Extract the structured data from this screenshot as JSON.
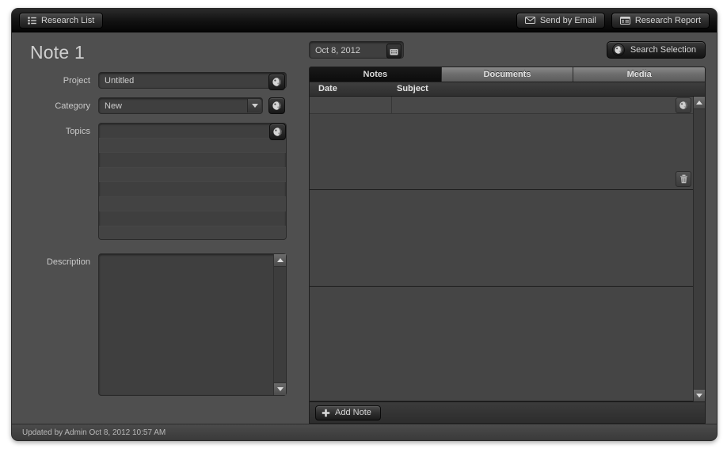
{
  "toolbar": {
    "research_list_label": "Research List",
    "research_list_icon": "list-icon",
    "send_email_label": "Send by Email",
    "send_email_icon": "envelope-icon",
    "research_report_label": "Research Report",
    "research_report_icon": "report-icon"
  },
  "left": {
    "title": "Note 1",
    "fields": {
      "project": {
        "label": "Project",
        "value": "Untitled",
        "icon": "globe-search-icon"
      },
      "category": {
        "label": "Category",
        "value": "New",
        "icon": "globe-search-icon",
        "dropdown_icon": "chevron-down-icon"
      },
      "topics": {
        "label": "Topics",
        "value": "",
        "icon": "globe-search-icon",
        "row_count": 8
      },
      "description": {
        "label": "Description",
        "value": "",
        "scroll_up_icon": "scroll-up-arrow-icon",
        "scroll_down_icon": "scroll-down-arrow-icon"
      }
    }
  },
  "right": {
    "date_field": {
      "value": "Oct 8, 2012",
      "calendar_icon": "calendar-icon"
    },
    "search_selection": {
      "label": "Search Selection",
      "icon": "globe-search-icon"
    },
    "tabs": [
      {
        "label": "Notes",
        "active": true
      },
      {
        "label": "Documents",
        "active": false
      },
      {
        "label": "Media",
        "active": false
      }
    ],
    "columns": [
      {
        "label": "Date"
      },
      {
        "label": "Subject"
      }
    ],
    "note_rows": [
      {
        "date": "",
        "subject": ""
      }
    ],
    "row_globe_icon": "globe-search-icon",
    "row_trash_icon": "trash-icon",
    "scroll_up_icon": "scroll-up-arrow-icon",
    "scroll_down_icon": "scroll-down-arrow-icon",
    "add_note": {
      "label": "Add Note",
      "icon": "plus-icon"
    }
  },
  "statusbar": {
    "text": "Updated by Admin Oct 8, 2012 10:57 AM"
  },
  "colors": {
    "window_bg": "#4f4f4f",
    "toolbar_bg": "#111111",
    "field_bg": "#3f3f3f",
    "text": "#cdcdcd",
    "active_tab": "#0c0c0c"
  }
}
